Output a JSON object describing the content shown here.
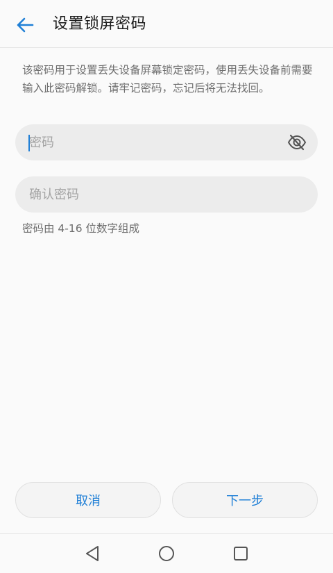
{
  "header": {
    "title": "设置锁屏密码",
    "back_icon": "arrow-left-icon"
  },
  "description": "该密码用于设置丢失设备屏幕锁定密码，使用丢失设备前需要输入此密码解锁。请牢记密码，忘记后将无法找回。",
  "password_field": {
    "placeholder": "密码",
    "value": "",
    "toggle_icon": "eye-off-icon"
  },
  "confirm_field": {
    "placeholder": "确认密码",
    "value": ""
  },
  "hint": "密码由 4-16 位数字组成",
  "buttons": {
    "cancel": "取消",
    "next": "下一步"
  },
  "navbar": {
    "icons": [
      "back-triangle-icon",
      "home-circle-icon",
      "recents-square-icon"
    ]
  },
  "colors": {
    "accent": "#1f7fd6",
    "background": "#fafafa",
    "field": "#ececec"
  }
}
